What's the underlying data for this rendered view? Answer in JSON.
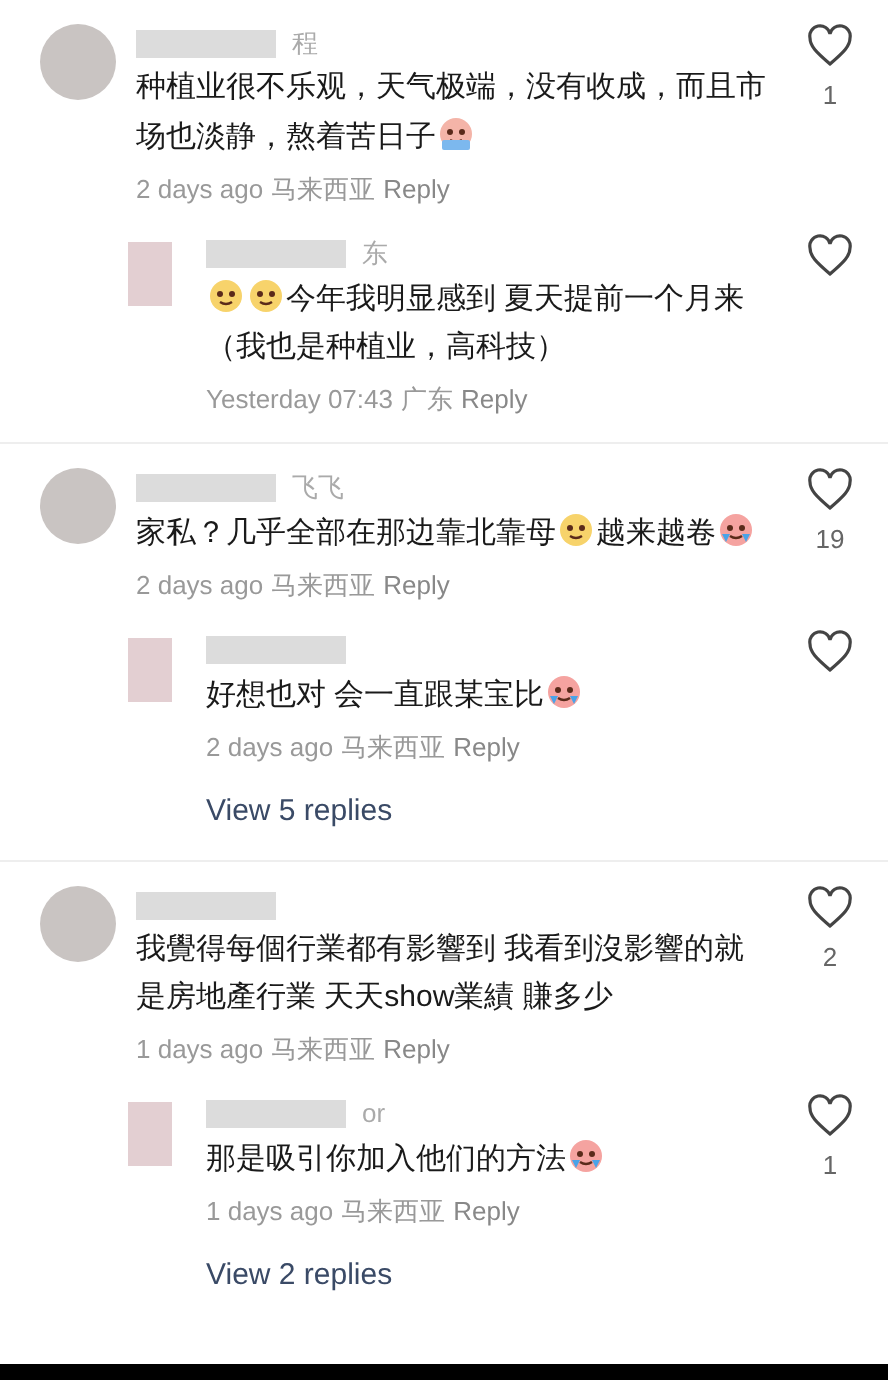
{
  "threads": [
    {
      "comment": {
        "username": "程",
        "segments": [
          {
            "kind": "text",
            "text": "种植业很不乐观，天气极端，没有收成，而且市场也淡静，熬着苦日子"
          },
          {
            "kind": "sweating"
          }
        ],
        "time": "2 days ago",
        "location": "马来西亚",
        "reply": "Reply",
        "liked": false,
        "likes": "1"
      },
      "replies": [
        {
          "username": "东",
          "segments": [
            {
              "kind": "blushing"
            },
            {
              "kind": "blushing"
            },
            {
              "kind": "text",
              "text": "今年我明显感到 夏天提前一个月来（我也是种植业，高科技）"
            }
          ],
          "time": "Yesterday 07:43",
          "location": "广东",
          "reply": "Reply",
          "liked": false
        }
      ]
    },
    {
      "comment": {
        "username": "飞飞",
        "segments": [
          {
            "kind": "text",
            "text": "家私？几乎全部在那边靠北靠母"
          },
          {
            "kind": "blushing"
          },
          {
            "kind": "text",
            "text": "越来越卷"
          },
          {
            "kind": "crying"
          }
        ],
        "time": "2 days ago",
        "location": "马来西亚",
        "reply": "Reply",
        "liked": false,
        "likes": "19"
      },
      "replies": [
        {
          "segments": [
            {
              "kind": "text",
              "text": "好想也对 会一直跟某宝比"
            },
            {
              "kind": "crying"
            }
          ],
          "time": "2 days ago",
          "location": "马来西亚",
          "reply": "Reply",
          "liked": false
        }
      ],
      "view_replies": "View 5 replies"
    },
    {
      "comment": {
        "segments": [
          {
            "kind": "text",
            "text": "我覺得每個行業都有影響到 我看到沒影響的就是房地產行業 天天show業績 賺多少"
          }
        ],
        "time": "1 days ago",
        "location": "马来西亚",
        "reply": "Reply",
        "liked": false,
        "likes": "2"
      },
      "replies": [
        {
          "username": "or",
          "segments": [
            {
              "kind": "text",
              "text": "那是吸引你加入他们的方法"
            },
            {
              "kind": "crying"
            }
          ],
          "time": "1 days ago",
          "location": "马来西亚",
          "reply": "Reply",
          "liked": false,
          "likes": "1"
        }
      ],
      "view_replies": "View 2 replies"
    }
  ]
}
